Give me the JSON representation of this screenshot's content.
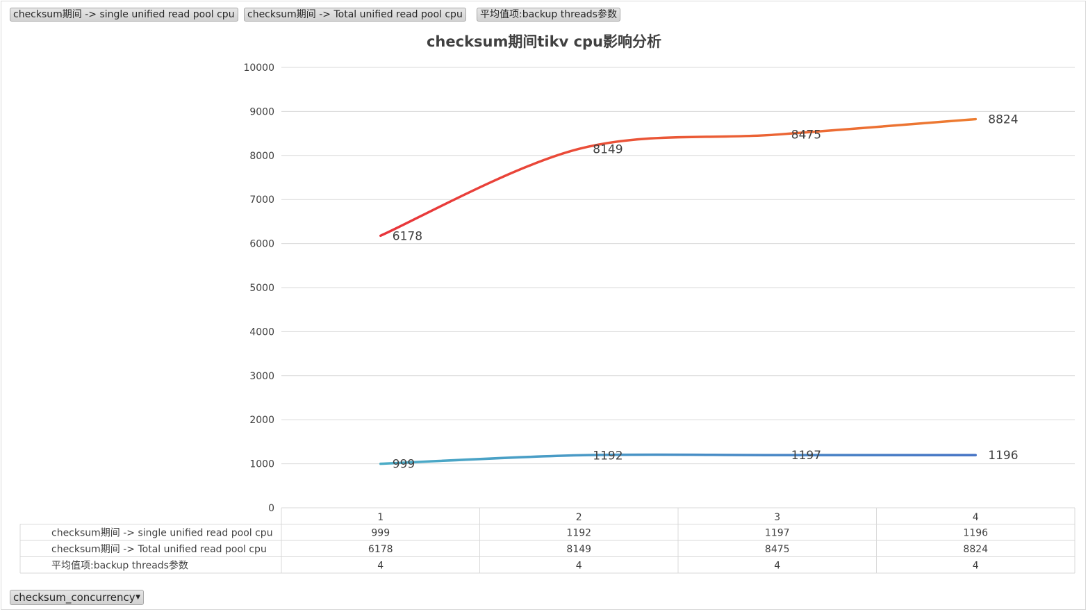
{
  "field_buttons": [
    "checksum期间 -> single unified read pool cpu",
    "checksum期间  -> Total unified read pool cpu",
    "平均值项:backup threads参数"
  ],
  "filter_button": {
    "label": "checksum_concurrency",
    "icon": "dropdown-arrow-icon"
  },
  "chart_data": {
    "type": "line",
    "title": "checksum期间tikv cpu影响分析",
    "categories": [
      "1",
      "2",
      "3",
      "4"
    ],
    "ylim": [
      0,
      10000
    ],
    "yticks": [
      0,
      1000,
      2000,
      3000,
      4000,
      5000,
      6000,
      7000,
      8000,
      9000,
      10000
    ],
    "grid": true,
    "smooth": true,
    "legend": "data-table-below",
    "series": [
      {
        "name": "checksum期间 -> single unified read pool cpu",
        "values": [
          999,
          1192,
          1197,
          1196
        ],
        "gradient": [
          "#4bacc6",
          "#4472c4"
        ],
        "table_values": [
          "999",
          "1192",
          "1197",
          "1196"
        ]
      },
      {
        "name": "checksum期间  -> Total unified read pool cpu",
        "values": [
          6178,
          8149,
          8475,
          8824
        ],
        "gradient": [
          "#e8343b",
          "#ed7d31"
        ],
        "table_values": [
          "6178",
          "8149",
          "8475",
          "8824"
        ]
      },
      {
        "name": "平均值项:backup threads参数",
        "values": [
          4,
          4,
          4,
          4
        ],
        "gradient": [
          "#f05a28",
          "#ffc000"
        ],
        "table_values": [
          "4",
          "4",
          "4",
          "4"
        ]
      }
    ],
    "data_labels": [
      {
        "series": 0,
        "text": [
          "999",
          "1192",
          "1197",
          "1196"
        ]
      },
      {
        "series": 1,
        "text": [
          "6178",
          "8149",
          "8475",
          "8824"
        ]
      }
    ]
  }
}
